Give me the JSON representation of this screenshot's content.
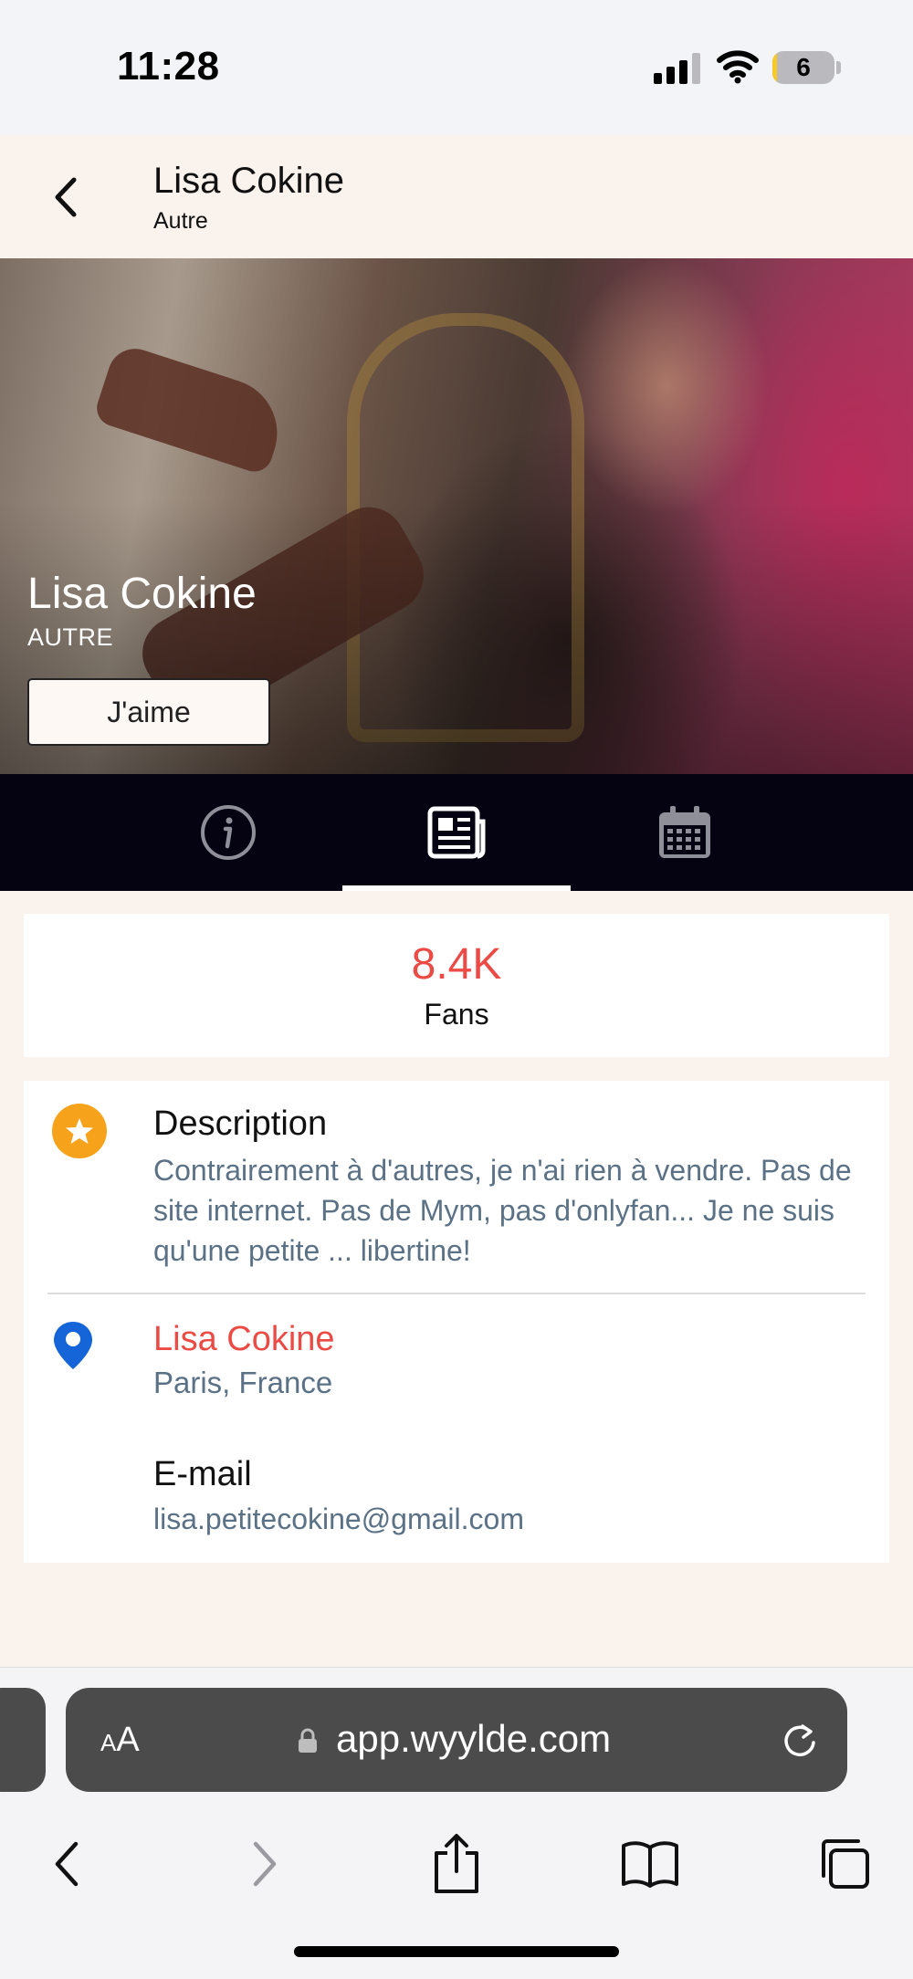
{
  "status_bar": {
    "time": "11:28",
    "battery_level": "6",
    "icons": [
      "signal-icon",
      "wifi-icon",
      "battery-icon"
    ]
  },
  "header": {
    "back_icon": "chevron-left-icon",
    "title": "Lisa Cokine",
    "subtitle": "Autre"
  },
  "hero": {
    "name": "Lisa Cokine",
    "type": "AUTRE",
    "like_label": "J'aime"
  },
  "tabs": [
    {
      "icon": "info-icon",
      "active": false
    },
    {
      "icon": "newspaper-icon",
      "active": true
    },
    {
      "icon": "calendar-icon",
      "active": false
    }
  ],
  "fans": {
    "count": "8.4K",
    "label": "Fans"
  },
  "description": {
    "icon": "star-icon",
    "title": "Description",
    "text": "Contrairement à d'autres, je n'ai rien à vendre. Pas de site internet. Pas de Mym, pas d'onlyfan... Je ne suis qu'une petite ... libertine!"
  },
  "location": {
    "icon": "location-pin-icon",
    "name": "Lisa Cokine",
    "city": "Paris, France"
  },
  "email": {
    "label": "E-mail",
    "value": "lisa.petitecokine@gmail.com"
  },
  "browser": {
    "text_size_big": "A",
    "text_size_small": "A",
    "url": "app.wyylde.com",
    "nav_icons": [
      "back-icon",
      "forward-icon",
      "share-icon",
      "bookmarks-icon",
      "tabs-icon"
    ]
  },
  "colors": {
    "accent": "#ec4b45",
    "muted_text": "#5b7186",
    "tabbar": "#050312",
    "background": "#f9f2ed",
    "star": "#f6a21b",
    "pin": "#1565d8"
  }
}
